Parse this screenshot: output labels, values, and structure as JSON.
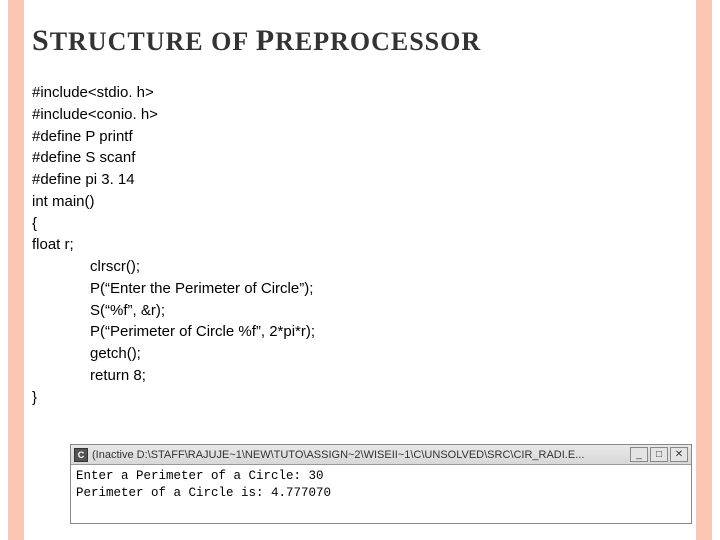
{
  "title": {
    "s_cap": "S",
    "tructure": "TRUCTURE",
    "of": " OF ",
    "p_cap": "P",
    "reprocessor": "REPROCESSOR"
  },
  "code": {
    "l1": "#include<stdio. h>",
    "l2": "#include<conio. h>",
    "l3": "#define P printf",
    "l4": "#define S scanf",
    "l5": "#define pi 3. 14",
    "l6": " int main()",
    "l7": "{",
    "l8": " float r;",
    "l9": "clrscr();",
    "l10": "P(“Enter the Perimeter of Circle”);",
    "l11": "S(“%f”, &r);",
    "l12": "P(“Perimeter of Circle %f”, 2*pi*r);",
    "l13": "getch();",
    "l14": "return 8;",
    "l15": "}"
  },
  "console": {
    "inactive": "(Inactive ",
    "path": "D:\\STAFF\\RAJUJE~1\\NEW\\TUTO\\ASSIGN~2\\WISEII~1\\C\\UNSOLVED\\SRC\\CIR_RADI.E...",
    "icon_char": "C",
    "line1": "Enter a Perimeter of a Circle: 30",
    "line2": "Perimeter of a Circle is: 4.777070",
    "buttons": {
      "min": "_",
      "max": "□",
      "close": "✕"
    }
  }
}
